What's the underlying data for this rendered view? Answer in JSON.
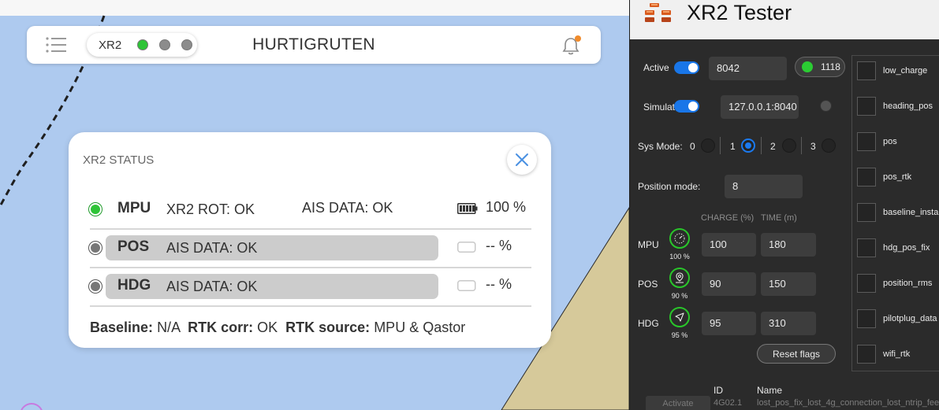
{
  "map_app": {
    "topbar": {
      "device_label": "XR2",
      "indicators": [
        {
          "name": "indicator-1",
          "color": "#2ec437"
        },
        {
          "name": "indicator-2",
          "color": "#8c8c8c"
        },
        {
          "name": "indicator-3",
          "color": "#8c8c8c"
        }
      ],
      "title": "HURTIGRUTEN",
      "notification_badge_color": "#f08b2c"
    },
    "status_card": {
      "title": "XR2 STATUS",
      "rows": [
        {
          "name": "MPU",
          "led_color": "#2ec437",
          "status1": "XR2 ROT: OK",
          "status2": "AIS DATA: OK",
          "battery_level": 1.0,
          "percent": "100 %"
        },
        {
          "name": "POS",
          "led_color": "#777777",
          "status1": "AIS DATA: OK",
          "status2": "",
          "battery_level": 0,
          "percent": "-- %"
        },
        {
          "name": "HDG",
          "led_color": "#777777",
          "status1": "AIS DATA: OK",
          "status2": "",
          "battery_level": 0,
          "percent": "-- %"
        }
      ],
      "baseline": {
        "label": "Baseline:",
        "value": "N/A"
      },
      "rtk_corr": {
        "label": "RTK corr:",
        "value": "OK"
      },
      "rtk_source": {
        "label": "RTK source:",
        "value": "MPU & Qastor"
      }
    }
  },
  "tester": {
    "title": "XR2 Tester",
    "active": {
      "label": "Active",
      "on": true,
      "port": "8042",
      "count": "1118"
    },
    "simulator": {
      "label": "Simulato",
      "on": true,
      "address": "127.0.0.1:8040"
    },
    "sys_mode": {
      "label": "Sys Mode:",
      "options": [
        "0",
        "1",
        "2",
        "3"
      ],
      "selected": "1"
    },
    "position_mode": {
      "label": "Position mode:",
      "value": "8"
    },
    "headers": {
      "charge": "CHARGE (%)",
      "time": "TIME (m)"
    },
    "units": [
      {
        "name": "MPU",
        "icon": "gauge-icon",
        "percent": "100 %",
        "charge": "100",
        "time": "180"
      },
      {
        "name": "POS",
        "icon": "map-pin-icon",
        "percent": "90 %",
        "charge": "90",
        "time": "150"
      },
      {
        "name": "HDG",
        "icon": "navigation-arrow-icon",
        "percent": "95 %",
        "charge": "95",
        "time": "310"
      }
    ],
    "reset_label": "Reset flags",
    "flags": [
      "low_charge",
      "heading_pos",
      "pos",
      "pos_rtk",
      "baseline_insta",
      "hdg_pos_fix",
      "position_rms",
      "pilotplug_data",
      "wifi_rtk"
    ],
    "table": {
      "headers": [
        "ID",
        "Name"
      ],
      "row": {
        "action": "Activate",
        "id": "4G02.1",
        "name": "lost_pos_fix_lost_4g_connection_lost_ntrip_fee"
      }
    }
  }
}
